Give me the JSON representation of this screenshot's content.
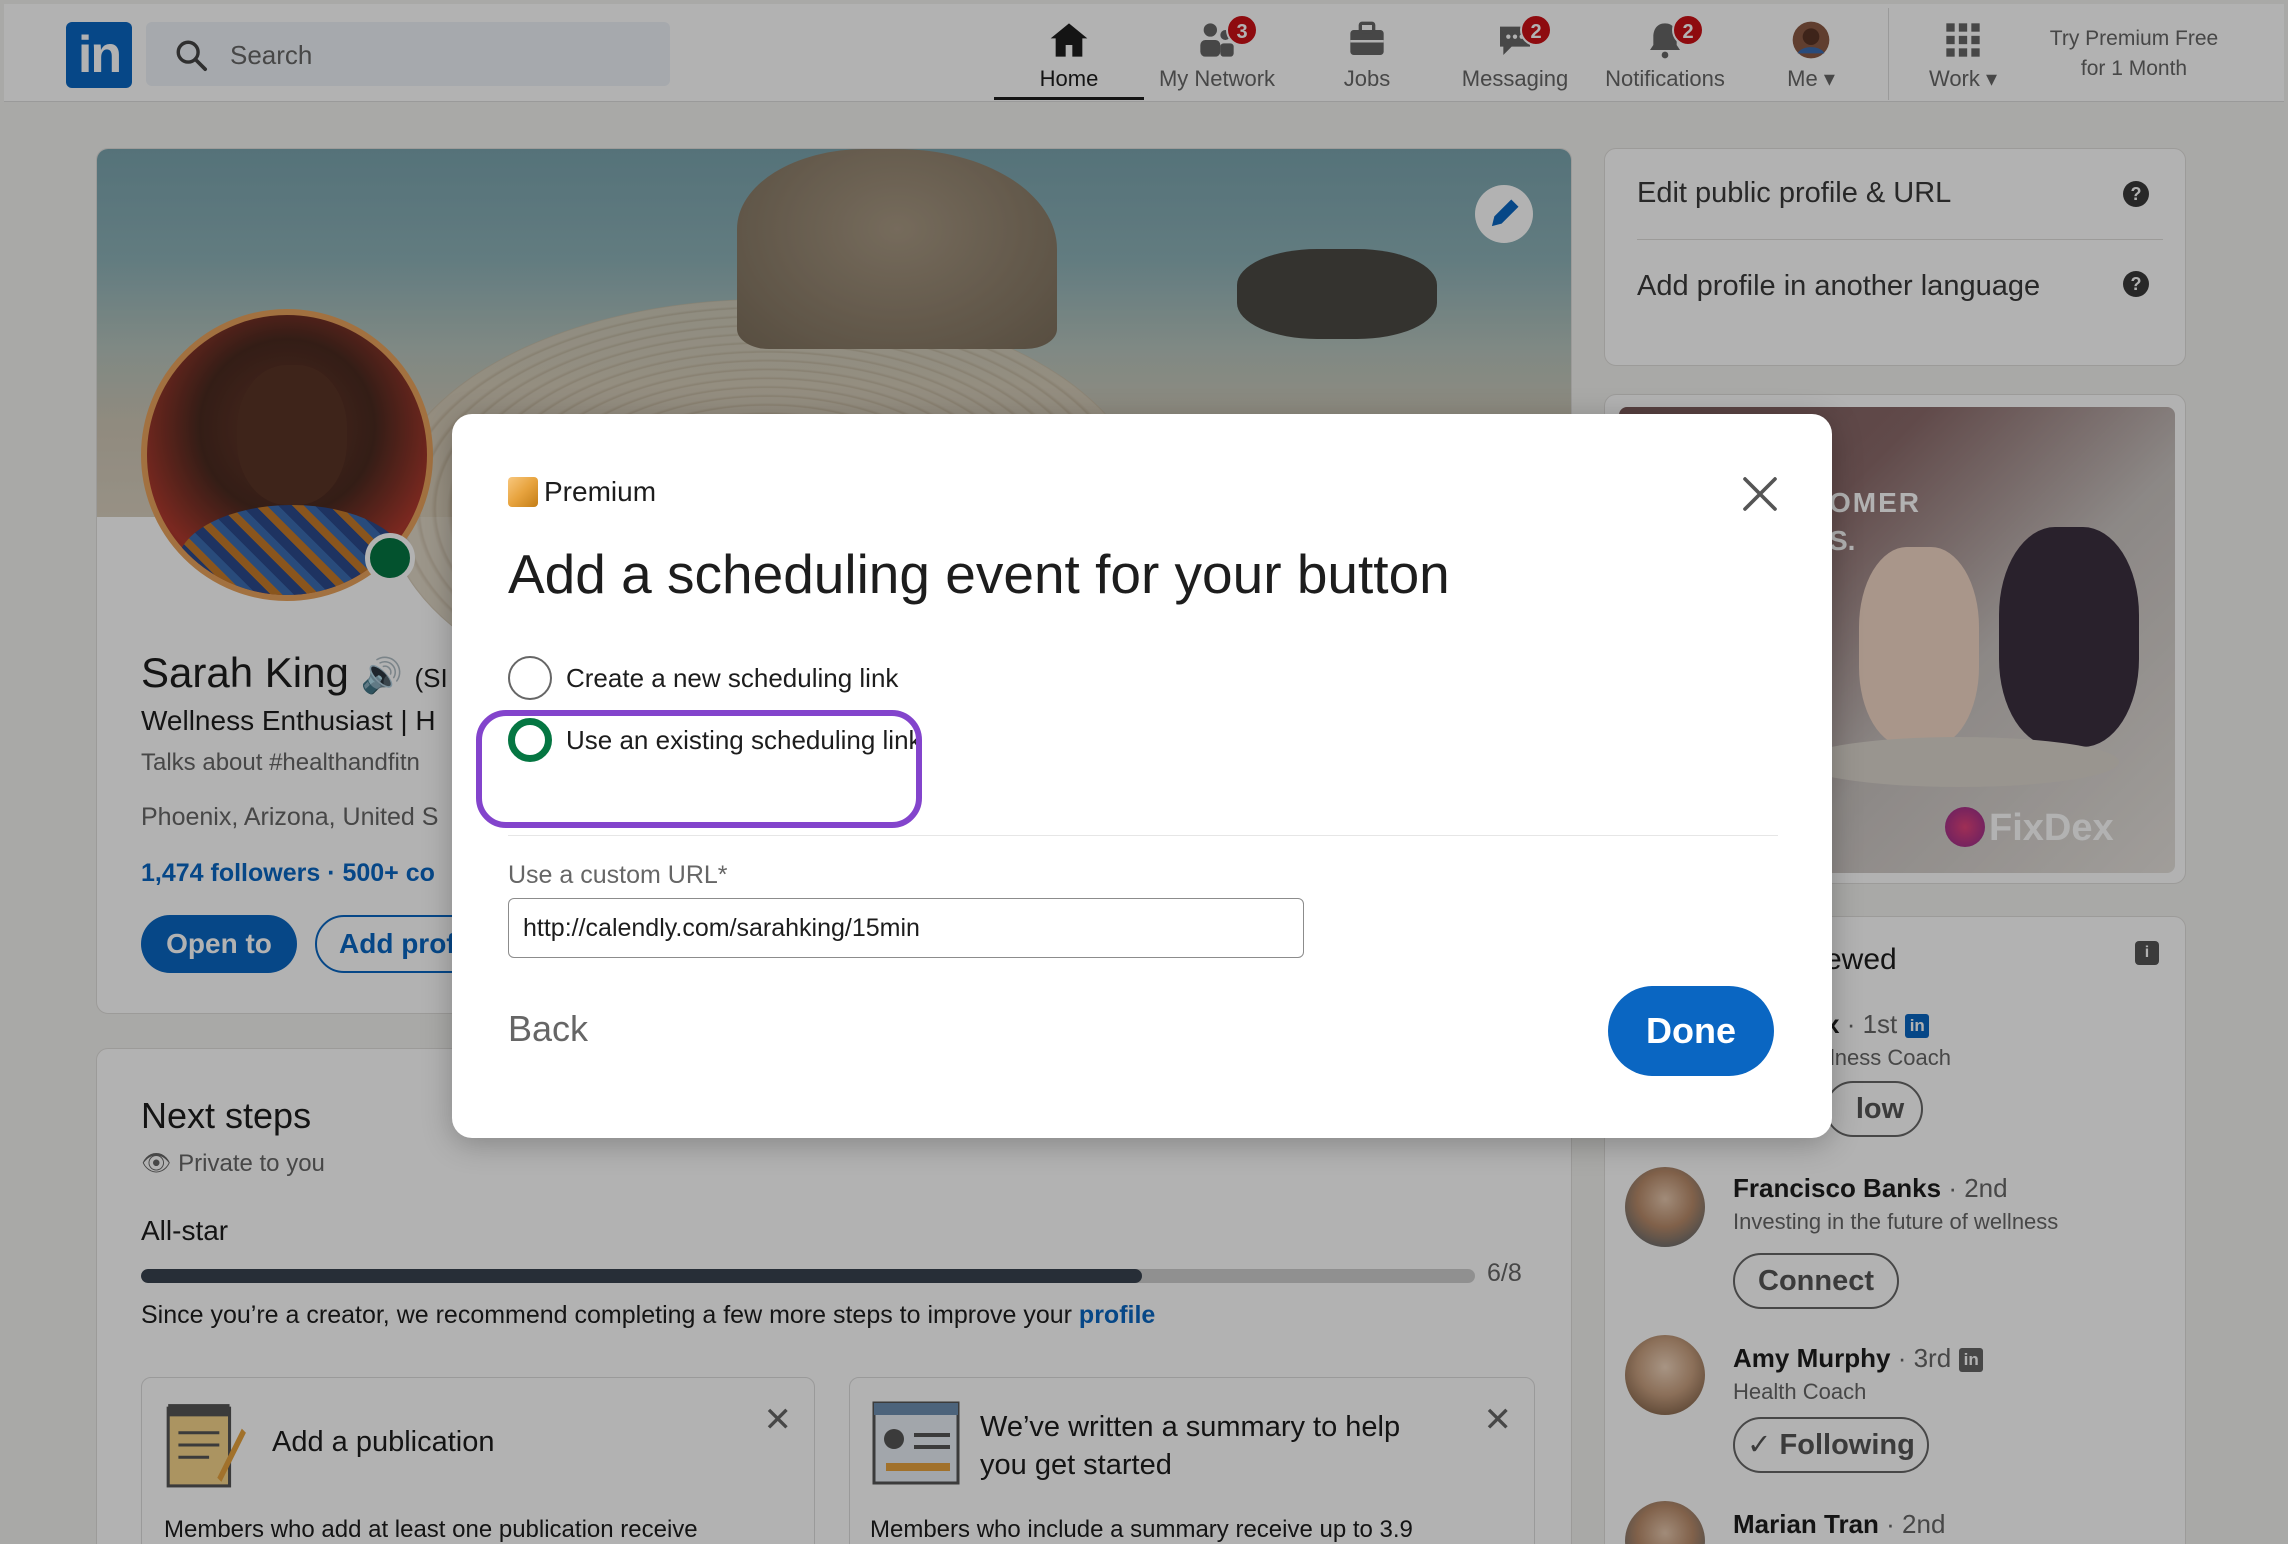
{
  "nav": {
    "search_placeholder": "Search",
    "items": [
      {
        "label": "Home",
        "badge": ""
      },
      {
        "label": "My Network",
        "badge": "3"
      },
      {
        "label": "Jobs",
        "badge": ""
      },
      {
        "label": "Messaging",
        "badge": "2"
      },
      {
        "label": "Notifications",
        "badge": "2"
      },
      {
        "label": "Me ▾",
        "badge": ""
      },
      {
        "label": "Work ▾",
        "badge": ""
      }
    ],
    "premium_line1": "Try Premium Free",
    "premium_line2": "for 1 Month"
  },
  "profile": {
    "name": "Sarah King",
    "pronouns": "(SI",
    "headline": "Wellness Enthusiast | H",
    "talks": "Talks about #healthandfitn",
    "location": "Phoenix, Arizona, United S",
    "followers": "1,474 followers · 500+ co",
    "open_to": "Open to",
    "add_profile": "Add prof"
  },
  "next_steps": {
    "title": "Next steps",
    "private": "Private to you",
    "level": "All-star",
    "progress_fraction": 0.75,
    "progress_count": "6/8",
    "recommend": "Since you’re a creator, we recommend completing a few more steps to improve your ",
    "recommend_link": "profile",
    "card1_title": "Add a publication",
    "card1_desc": "Members who add at least one publication receive",
    "card2_title_l1": "We’ve written a summary to help",
    "card2_title_l2": "you get started",
    "card2_desc": "Members who include a summary receive up to 3.9"
  },
  "rail": {
    "edit_url": "Edit public  profile & URL",
    "add_lang": "Add profile in another language",
    "ad_brand": "FixDex",
    "ad_text1": "OMER",
    "ad_text2": "S.",
    "viewed_title": "ewed",
    "p1_name": "x",
    "p1_deg": " · 1st",
    "p1_sub": "llness Coach",
    "p1_btn": "low",
    "p2_name": "Francisco Banks",
    "p2_deg": " · 2nd",
    "p2_sub": "Investing in the future of wellness",
    "p2_btn": "Connect",
    "p3_name": "Amy Murphy",
    "p3_deg": " · 3rd",
    "p3_sub": "Health Coach",
    "p3_btn": "✓ Following",
    "p4_name": "Marian Tran",
    "p4_deg": " · 2nd"
  },
  "modal": {
    "brand": "Premium",
    "title": "Add a scheduling event for your button",
    "option_new": "Create a new scheduling link",
    "option_existing": "Use an existing scheduling link",
    "url_label": "Use a custom URL*",
    "url_value": "http://calendly.com/sarahking/15min",
    "back": "Back",
    "done": "Done"
  },
  "colors": {
    "brand_blue": "#0a66c2",
    "radio_green": "#057642",
    "highlight_purple": "#8344cc",
    "badge_red": "#cc1016"
  }
}
